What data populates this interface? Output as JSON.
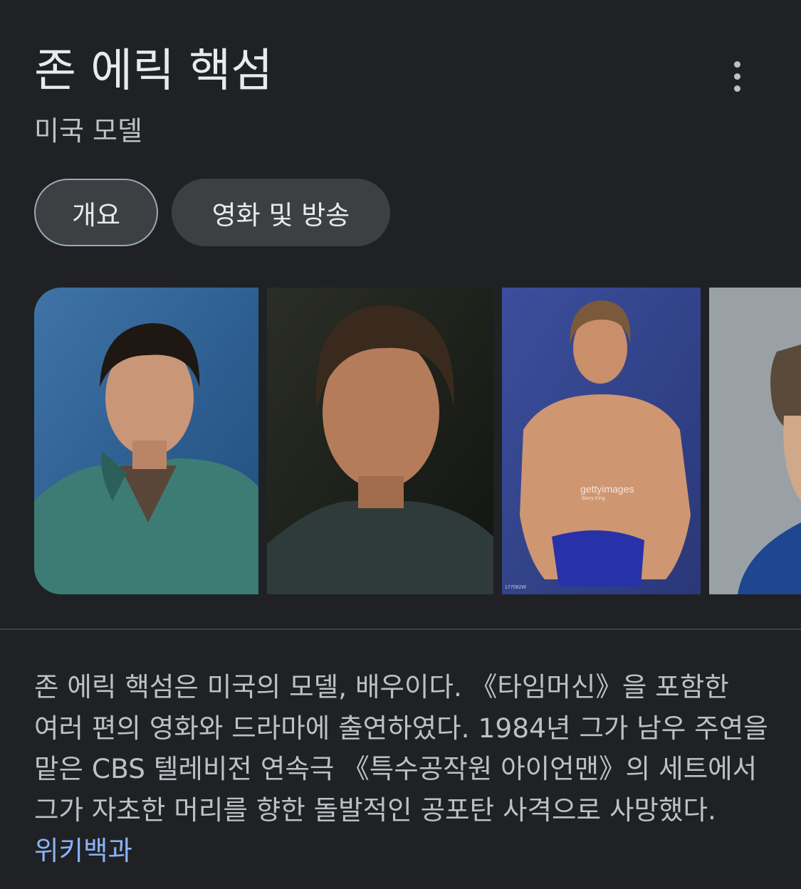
{
  "header": {
    "title": "존 에릭 핵섬",
    "subtitle": "미국 모델",
    "more_icon": "more-vert-icon"
  },
  "chips": [
    {
      "label": "개요",
      "selected": true
    },
    {
      "label": "영화 및 방송",
      "selected": false
    }
  ],
  "photos": [
    {
      "name": "photo-1"
    },
    {
      "name": "photo-2"
    },
    {
      "name": "photo-3",
      "watermark": "gettyimages",
      "credit": "Barry King",
      "id_text": "177082W"
    },
    {
      "name": "photo-4"
    }
  ],
  "description": {
    "text": "존 에릭 핵섬은 미국의 모델, 배우이다. 《타임머신》을 포함한 여러 편의 영화와 드라마에 출연하였다. 1984년 그가 남우 주연을 맡은 CBS 텔레비전 연속극 《특수공작원 아이언맨》의 세트에서 그가 자초한 머리를 향한 돌발적인 공포탄 사격으로 사망했다.",
    "link_label": "위키백과"
  },
  "colors": {
    "background": "#202124",
    "text": "#e8eaed",
    "secondary_text": "#bdc1c6",
    "link": "#8ab4f8",
    "chip_bg": "#3c4043"
  }
}
